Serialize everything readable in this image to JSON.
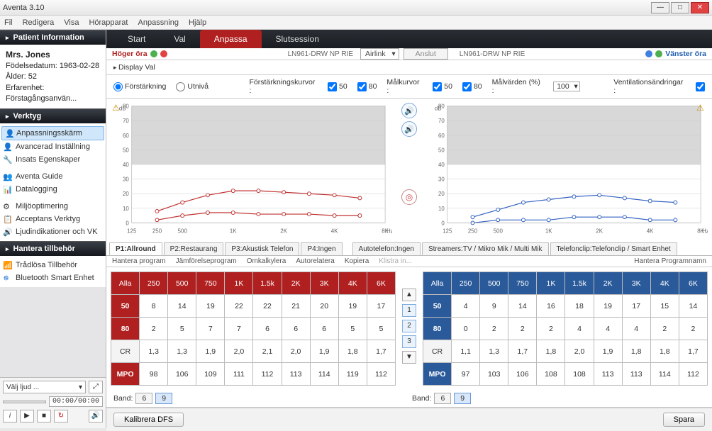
{
  "window": {
    "title": "Aventa 3.10"
  },
  "menu": [
    "Fil",
    "Redigera",
    "Visa",
    "Hörapparat",
    "Anpassning",
    "Hjälp"
  ],
  "patient_panel": {
    "title": "Patient Information",
    "name": "Mrs. Jones",
    "birth": "Födelsedatum: 1963-02-28",
    "age": "Ålder: 52",
    "experience": "Erfarenhet: Förstagångsanvän..."
  },
  "tools_panel": {
    "title": "Verktyg",
    "items": [
      "Anpassningsskärm",
      "Avancerad Inställning",
      "Insats Egenskaper",
      "Aventa Guide",
      "Datalogging",
      "Miljöoptimering",
      "Acceptans Verktyg",
      "Ljudindikationer och VK"
    ]
  },
  "accessories_panel": {
    "title": "Hantera tillbehör",
    "items": [
      "Trådlösa Tillbehör",
      "Bluetooth Smart Enhet"
    ]
  },
  "media": {
    "select": "Välj ljud ...",
    "time": "00:00/00:00"
  },
  "nav": {
    "tabs": [
      "Start",
      "Val",
      "Anpassa",
      "Slutsession"
    ],
    "active": 2
  },
  "ear_bar": {
    "left_label": "Höger öra",
    "right_label": "Vänster öra",
    "device_left": "LN961-DRW NP RIE",
    "device_right": "LN961-DRW NP RIE",
    "link": "Airlink",
    "connect": "Anslut"
  },
  "options": {
    "display": "Display Val",
    "gain": "Förstärkning",
    "output": "Utnivå",
    "gain_curves": "Förstärkningskurvor :",
    "target_curves": "Målkurvor :",
    "target_values": "Målvärden (%) :",
    "target_pct": "100",
    "vent": "Ventilationsändringar :",
    "cb50": "50",
    "cb80": "80"
  },
  "chart_data": [
    {
      "type": "line",
      "ylabel": "dB",
      "xlabel": "Hz",
      "ylim": [
        0,
        80
      ],
      "yticks": [
        0,
        10,
        20,
        30,
        40,
        50,
        60,
        70,
        80
      ],
      "xticks": [
        "125",
        "250",
        "500",
        "1K",
        "2K",
        "4K",
        "8K"
      ],
      "color": "#c03030",
      "series": [
        {
          "name": "80",
          "x": [
            "250",
            "500",
            "750",
            "1K",
            "1.5K",
            "2K",
            "3K",
            "4K",
            "6K"
          ],
          "values": [
            8,
            14,
            19,
            22,
            22,
            21,
            20,
            19,
            17
          ]
        },
        {
          "name": "50",
          "x": [
            "250",
            "500",
            "750",
            "1K",
            "1.5K",
            "2K",
            "3K",
            "4K",
            "6K"
          ],
          "values": [
            2,
            5,
            7,
            7,
            6,
            6,
            6,
            5,
            5
          ]
        }
      ]
    },
    {
      "type": "line",
      "ylabel": "dB",
      "xlabel": "Hz",
      "ylim": [
        0,
        80
      ],
      "yticks": [
        0,
        10,
        20,
        30,
        40,
        50,
        60,
        70,
        80
      ],
      "xticks": [
        "125",
        "250",
        "500",
        "1K",
        "2K",
        "4K",
        "8K"
      ],
      "color": "#3060c0",
      "series": [
        {
          "name": "80",
          "x": [
            "250",
            "500",
            "750",
            "1K",
            "1.5K",
            "2K",
            "3K",
            "4K",
            "6K"
          ],
          "values": [
            4,
            9,
            14,
            16,
            18,
            19,
            17,
            15,
            14
          ]
        },
        {
          "name": "50",
          "x": [
            "250",
            "500",
            "750",
            "1K",
            "1.5K",
            "2K",
            "3K",
            "4K",
            "6K"
          ],
          "values": [
            0,
            2,
            2,
            2,
            4,
            4,
            4,
            2,
            2
          ]
        }
      ]
    }
  ],
  "prog_tabs": [
    "P1:Allround",
    "P2:Restaurang",
    "P3:Akustisk Telefon",
    "P4:Ingen",
    "Autotelefon:Ingen",
    "Streamers:TV / Mikro Mik / Multi Mik",
    "Telefonclip:Telefonclip / Smart Enhet"
  ],
  "sub_tabs": {
    "items": [
      "Hantera program",
      "Jämförelseprogram",
      "Omkalkylera",
      "Autorelatera",
      "Kopiera",
      "Klistra in..."
    ],
    "right": "Hantera Programnamn"
  },
  "table_headers": [
    "Alla",
    "250",
    "500",
    "750",
    "1K",
    "1.5k",
    "2K",
    "3K",
    "4K",
    "6K"
  ],
  "right_tbl": {
    "r50": [
      "8",
      "14",
      "19",
      "22",
      "22",
      "21",
      "20",
      "19",
      "17"
    ],
    "r80": [
      "2",
      "5",
      "7",
      "7",
      "6",
      "6",
      "6",
      "5",
      "5"
    ],
    "cr": [
      "1,3",
      "1,3",
      "1,9",
      "2,0",
      "2,1",
      "2,0",
      "1,9",
      "1,8",
      "1,7"
    ],
    "mpo": [
      "98",
      "106",
      "109",
      "111",
      "112",
      "113",
      "114",
      "119",
      "112"
    ]
  },
  "left_tbl": {
    "r50": [
      "4",
      "9",
      "14",
      "16",
      "18",
      "19",
      "17",
      "15",
      "14"
    ],
    "r80": [
      "0",
      "2",
      "2",
      "2",
      "4",
      "4",
      "4",
      "2",
      "2"
    ],
    "cr": [
      "1,1",
      "1,3",
      "1,7",
      "1,8",
      "2,0",
      "1,9",
      "1,8",
      "1,8",
      "1,7"
    ],
    "mpo": [
      "97",
      "103",
      "106",
      "108",
      "108",
      "113",
      "113",
      "114",
      "112"
    ]
  },
  "row_labels": {
    "r50": "50",
    "r80": "80",
    "cr": "CR",
    "mpo": "MPO"
  },
  "steps": [
    "1",
    "2",
    "3"
  ],
  "band": {
    "label": "Band:",
    "b6": "6",
    "b9": "9"
  },
  "footer": {
    "calibrate": "Kalibrera DFS",
    "save": "Spara"
  }
}
